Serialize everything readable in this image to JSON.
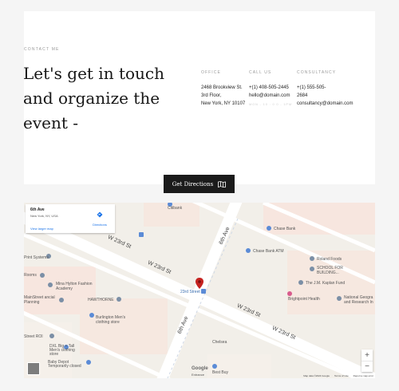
{
  "contact": {
    "eyebrow": "CONTACT ME",
    "headline": "Let's get in touch and organize the event -",
    "office": {
      "head": "OFFICE",
      "lines": [
        "2468 Brookview St.",
        "3rd Floor,",
        "New York, NY 10107"
      ]
    },
    "call": {
      "head": "CALL US",
      "lines": [
        "+(1) 408-505-2445",
        "hello@domain.com"
      ],
      "faded": "MON - 10 : 0 0 - 1PM"
    },
    "consultancy": {
      "head": "CONSULTANCY",
      "lines": [
        "+(1) 555-505-",
        "2684",
        "consultancy@domain.com"
      ]
    }
  },
  "button": {
    "label": "Get Directions",
    "icon": "map-book-icon"
  },
  "map": {
    "info": {
      "title": "6th Ave",
      "subtitle": "New York, NY, USA",
      "link": "View larger map",
      "directions": "Directions"
    },
    "roads": {
      "w23_a": "W 23rd St",
      "w23_b": "W 23rd St",
      "w23_c": "W 23rd St",
      "w23_d": "W 23rd St",
      "sixth_a": "6th Ave",
      "sixth_b": "6th Ave"
    },
    "labels": {
      "citibank": "Citibank",
      "chase": "Chase Bank",
      "chase_atm": "Chase Bank ATM",
      "roland": "Roland Foods",
      "school": "SCHOOL FOR BUILDING...",
      "kaplan": "The J.M. Kaplan Fund",
      "brightpoint": "Brightpoint Health",
      "national": "National Geogra and Research In",
      "print": "Print Systems",
      "rooms": "Rooms",
      "mina": "Mina Hylton Fashion Academy",
      "mainstreet": "MainStreet ancial Planning",
      "hawthorne": "HAWTHORNE",
      "burlington": "Burlington Men's clothing store",
      "street_roi": "Street ROI",
      "dxl": "DXL Big + Tall Men's clothing store",
      "babydepot": "Baby Depot Temporarily closed",
      "station": "23rd Street",
      "google": "Google",
      "bestbuy": "Best Buy",
      "entrance": "Entrance",
      "chelsea": "Chelsea"
    },
    "attribution": [
      "Map data ©2024 Google",
      "Terms of Use",
      "Report a map error"
    ],
    "zoom_in": "+",
    "zoom_out": "−"
  },
  "colors": {
    "button_bg": "#1b1b1b",
    "map_bg": "#f2efe9",
    "road": "#ffffff",
    "marker": "#c5221f"
  }
}
